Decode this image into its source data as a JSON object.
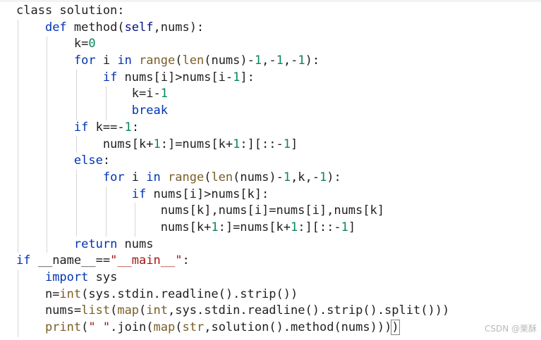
{
  "editor": {
    "lines": [
      [
        {
          "t": "class solution:",
          "c": "plain"
        }
      ],
      [
        {
          "t": "    ",
          "c": "plain"
        },
        {
          "t": "def",
          "c": "kw"
        },
        {
          "t": " method(",
          "c": "plain"
        },
        {
          "t": "self",
          "c": "self"
        },
        {
          "t": ",nums):",
          "c": "plain"
        }
      ],
      [
        {
          "t": "        k=",
          "c": "plain"
        },
        {
          "t": "0",
          "c": "num"
        }
      ],
      [
        {
          "t": "        ",
          "c": "plain"
        },
        {
          "t": "for",
          "c": "kw"
        },
        {
          "t": " i ",
          "c": "plain"
        },
        {
          "t": "in",
          "c": "kw"
        },
        {
          "t": " ",
          "c": "plain"
        },
        {
          "t": "range",
          "c": "fn"
        },
        {
          "t": "(",
          "c": "plain"
        },
        {
          "t": "len",
          "c": "fn"
        },
        {
          "t": "(nums)-",
          "c": "plain"
        },
        {
          "t": "1",
          "c": "num"
        },
        {
          "t": ",-",
          "c": "plain"
        },
        {
          "t": "1",
          "c": "num"
        },
        {
          "t": ",-",
          "c": "plain"
        },
        {
          "t": "1",
          "c": "num"
        },
        {
          "t": "):",
          "c": "plain"
        }
      ],
      [
        {
          "t": "            ",
          "c": "plain"
        },
        {
          "t": "if",
          "c": "kw"
        },
        {
          "t": " nums[i]>nums[i-",
          "c": "plain"
        },
        {
          "t": "1",
          "c": "num"
        },
        {
          "t": "]:",
          "c": "plain"
        }
      ],
      [
        {
          "t": "                k=i-",
          "c": "plain"
        },
        {
          "t": "1",
          "c": "num"
        }
      ],
      [
        {
          "t": "                ",
          "c": "plain"
        },
        {
          "t": "break",
          "c": "kw"
        }
      ],
      [
        {
          "t": "        ",
          "c": "plain"
        },
        {
          "t": "if",
          "c": "kw"
        },
        {
          "t": " k==-",
          "c": "plain"
        },
        {
          "t": "1",
          "c": "num"
        },
        {
          "t": ":",
          "c": "plain"
        }
      ],
      [
        {
          "t": "            nums[k+",
          "c": "plain"
        },
        {
          "t": "1",
          "c": "num"
        },
        {
          "t": ":]=nums[k+",
          "c": "plain"
        },
        {
          "t": "1",
          "c": "num"
        },
        {
          "t": ":][::-",
          "c": "plain"
        },
        {
          "t": "1",
          "c": "num"
        },
        {
          "t": "]",
          "c": "plain"
        }
      ],
      [
        {
          "t": "        ",
          "c": "plain"
        },
        {
          "t": "else",
          "c": "kw"
        },
        {
          "t": ":",
          "c": "plain"
        }
      ],
      [
        {
          "t": "            ",
          "c": "plain"
        },
        {
          "t": "for",
          "c": "kw"
        },
        {
          "t": " i ",
          "c": "plain"
        },
        {
          "t": "in",
          "c": "kw"
        },
        {
          "t": " ",
          "c": "plain"
        },
        {
          "t": "range",
          "c": "fn"
        },
        {
          "t": "(",
          "c": "plain"
        },
        {
          "t": "len",
          "c": "fn"
        },
        {
          "t": "(nums)-",
          "c": "plain"
        },
        {
          "t": "1",
          "c": "num"
        },
        {
          "t": ",k,-",
          "c": "plain"
        },
        {
          "t": "1",
          "c": "num"
        },
        {
          "t": "):",
          "c": "plain"
        }
      ],
      [
        {
          "t": "                ",
          "c": "plain"
        },
        {
          "t": "if",
          "c": "kw"
        },
        {
          "t": " nums[i]>nums[k]:",
          "c": "plain"
        }
      ],
      [
        {
          "t": "                    nums[k],nums[i]=nums[i],nums[k]",
          "c": "plain"
        }
      ],
      [
        {
          "t": "                    nums[k+",
          "c": "plain"
        },
        {
          "t": "1",
          "c": "num"
        },
        {
          "t": ":]=nums[k+",
          "c": "plain"
        },
        {
          "t": "1",
          "c": "num"
        },
        {
          "t": ":][::-",
          "c": "plain"
        },
        {
          "t": "1",
          "c": "num"
        },
        {
          "t": "]",
          "c": "plain"
        }
      ],
      [
        {
          "t": "        ",
          "c": "plain"
        },
        {
          "t": "return",
          "c": "kw"
        },
        {
          "t": " nums",
          "c": "plain"
        }
      ],
      [
        {
          "t": "if",
          "c": "kw"
        },
        {
          "t": " __name__==",
          "c": "plain"
        },
        {
          "t": "\"__main__\"",
          "c": "str"
        },
        {
          "t": ":",
          "c": "plain"
        }
      ],
      [
        {
          "t": "    ",
          "c": "plain"
        },
        {
          "t": "import",
          "c": "kw"
        },
        {
          "t": " sys",
          "c": "plain"
        }
      ],
      [
        {
          "t": "    n=",
          "c": "plain"
        },
        {
          "t": "int",
          "c": "fn"
        },
        {
          "t": "(sys.stdin.readline().strip())",
          "c": "plain"
        }
      ],
      [
        {
          "t": "    nums=",
          "c": "plain"
        },
        {
          "t": "list",
          "c": "fn"
        },
        {
          "t": "(",
          "c": "plain"
        },
        {
          "t": "map",
          "c": "fn"
        },
        {
          "t": "(",
          "c": "plain"
        },
        {
          "t": "int",
          "c": "fn"
        },
        {
          "t": ",sys.stdin.readline().strip().split()))",
          "c": "plain"
        }
      ],
      [
        {
          "t": "    ",
          "c": "plain"
        },
        {
          "t": "print",
          "c": "fn"
        },
        {
          "t": "(",
          "c": "plain"
        },
        {
          "t": "\" \"",
          "c": "str"
        },
        {
          "t": ".join(",
          "c": "plain"
        },
        {
          "t": "map",
          "c": "fn"
        },
        {
          "t": "(",
          "c": "plain"
        },
        {
          "t": "str",
          "c": "fn"
        },
        {
          "t": ",solution().method(nums)))",
          "c": "plain"
        },
        {
          "t": ")",
          "c": "cursor"
        }
      ]
    ]
  },
  "colors": {
    "background": "#ffffff",
    "keyword": "#0033b3",
    "function": "#795e26",
    "number": "#098658",
    "string": "#a31515",
    "text": "#1f1f1f",
    "indent_guide": "#d6d6d6"
  },
  "watermark": "CSDN @栗酥"
}
